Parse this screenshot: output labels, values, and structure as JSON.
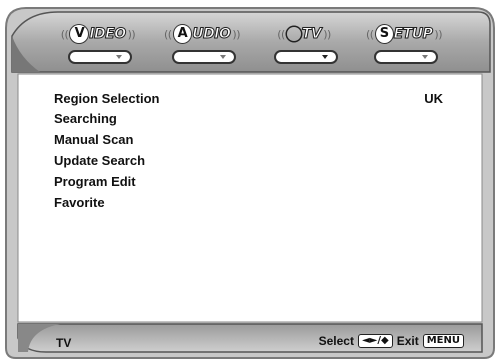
{
  "tabs": [
    {
      "id": "video",
      "letter": "V",
      "word": "IDEO",
      "icon": "video-tab-icon"
    },
    {
      "id": "audio",
      "letter": "A",
      "word": "UDIO",
      "icon": "audio-tab-icon"
    },
    {
      "id": "tv",
      "letter": "",
      "word": "TV",
      "icon": "tv-tab-icon"
    },
    {
      "id": "setup",
      "letter": "S",
      "word": "ETUP",
      "icon": "setup-tab-icon"
    }
  ],
  "active_tab": "tv",
  "menu": {
    "items": [
      {
        "label": "Region Selection",
        "value": "UK"
      },
      {
        "label": "Searching",
        "value": ""
      },
      {
        "label": "Manual Scan",
        "value": ""
      },
      {
        "label": "Update Search",
        "value": ""
      },
      {
        "label": "Program Edit",
        "value": ""
      },
      {
        "label": "Favorite",
        "value": ""
      }
    ]
  },
  "footer": {
    "mode": "TV",
    "select_label": "Select",
    "select_keys": "◄►/◆",
    "exit_label": "Exit",
    "exit_key": "MENU"
  },
  "colors": {
    "frame_gray": "#b8b8b8",
    "frame_dark": "#6e6e6e",
    "panel_bg": "#ffffff",
    "text": "#111111"
  }
}
